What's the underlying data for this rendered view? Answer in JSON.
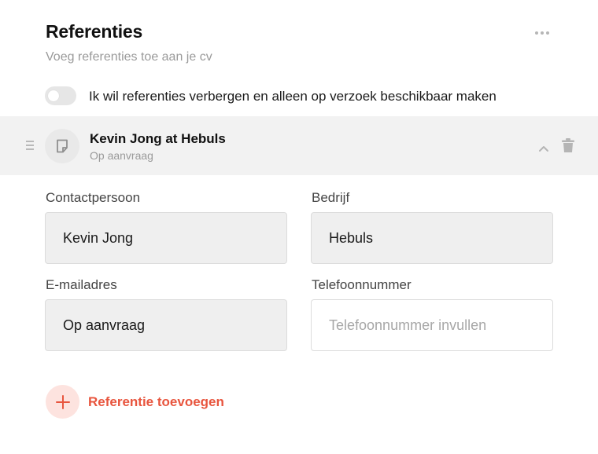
{
  "section": {
    "title": "Referenties",
    "subtitle": "Voeg referenties toe aan je cv",
    "more_icon": "more-horizontal-icon"
  },
  "toggle": {
    "label": "Ik wil referenties verbergen en alleen op verzoek beschikbaar maken",
    "on": false
  },
  "reference": {
    "title": "Kevin Jong at Hebuls",
    "subtitle": "Op aanvraag",
    "icon": "document-icon",
    "expanded": true
  },
  "form": {
    "contact": {
      "label": "Contactpersoon",
      "value": "Kevin Jong"
    },
    "company": {
      "label": "Bedrijf",
      "value": "Hebuls"
    },
    "email": {
      "label": "E-mailadres",
      "value": "Op aanvraag"
    },
    "phone": {
      "label": "Telefoonnummer",
      "value": "",
      "placeholder": "Telefoonnummer invullen"
    }
  },
  "add": {
    "label": "Referentie toevoegen",
    "accent": "#e8553e",
    "accent_bg": "#fde3df"
  }
}
